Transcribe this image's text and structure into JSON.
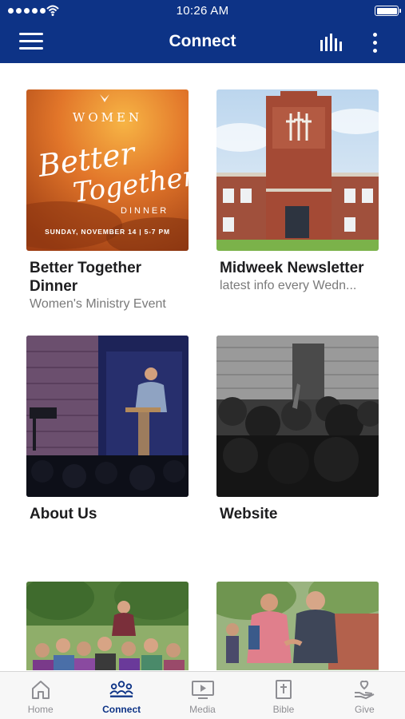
{
  "status_bar": {
    "time": "10:26 AM"
  },
  "header": {
    "title": "Connect"
  },
  "flyer": {
    "heading": "WOMEN",
    "line1": "Better",
    "line2": "Together",
    "line3": "DINNER",
    "date": "SUNDAY, NOVEMBER 14 | 5-7 PM"
  },
  "cards": [
    {
      "title": "Better Together Dinner",
      "subtitle": "Women's Ministry Event"
    },
    {
      "title": "Midweek Newsletter",
      "subtitle": "latest info every Wedn..."
    },
    {
      "title": "About Us",
      "subtitle": ""
    },
    {
      "title": "Website",
      "subtitle": ""
    },
    {
      "title": "",
      "subtitle": ""
    },
    {
      "title": "",
      "subtitle": ""
    }
  ],
  "tabs": [
    {
      "label": "Home",
      "icon": "home-icon",
      "active": false
    },
    {
      "label": "Connect",
      "icon": "people-icon",
      "active": true
    },
    {
      "label": "Media",
      "icon": "tv-play-icon",
      "active": false
    },
    {
      "label": "Bible",
      "icon": "bible-cross-icon",
      "active": false
    },
    {
      "label": "Give",
      "icon": "giving-hand-icon",
      "active": false
    }
  ],
  "colors": {
    "brand": "#0d3386",
    "inactive_tab": "#8e8e93",
    "title_text": "#1d1d1f",
    "subtitle_text": "#7a7a7a"
  }
}
